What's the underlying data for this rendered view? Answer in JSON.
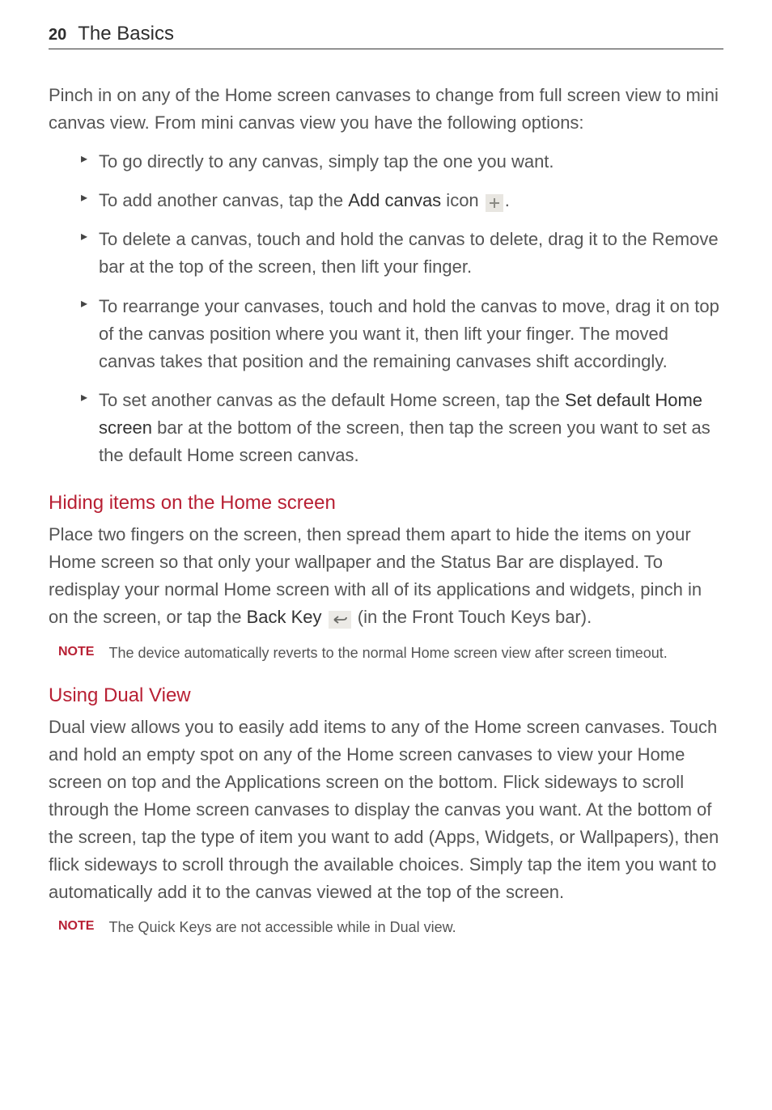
{
  "header": {
    "page_number": "20",
    "section": "The Basics"
  },
  "intro": "Pinch in on any of the Home screen canvases to change from full screen view to mini canvas view. From mini canvas view you have the following options:",
  "bullets": {
    "b1": "To go directly to any canvas, simply tap the one you want.",
    "b2_a": "To add another canvas, tap the ",
    "b2_bold": "Add canvas",
    "b2_b": " icon ",
    "b2_c": ".",
    "b3": "To delete a canvas, touch and hold the canvas to delete, drag it to the Remove bar at the top of the screen, then lift your finger.",
    "b4": "To rearrange your canvases, touch and hold the canvas to move, drag it on top of the canvas position where you want it, then lift your finger. The moved canvas takes that position and the remaining canvases shift accordingly.",
    "b5_a": "To set another canvas as the default Home screen, tap the ",
    "b5_bold": "Set default Home screen",
    "b5_b": " bar at the bottom of the screen, then tap the screen you want to set as the default Home screen canvas."
  },
  "hiding": {
    "heading": "Hiding items on the Home screen",
    "p_a": "Place two fingers on the screen, then spread them apart to hide the items on your Home screen so that only your wallpaper and the Status Bar are displayed. To redisplay your normal Home screen with all of its applications and widgets, pinch in on the screen, or tap the ",
    "p_bold": "Back Key",
    "p_b": " (in the Front Touch Keys bar).",
    "note_label": "NOTE",
    "note_text": "The device automatically reverts to the normal Home screen view after screen timeout."
  },
  "dual": {
    "heading": "Using Dual View",
    "p": "Dual view allows you to easily add items to any of the Home screen canvases. Touch and hold an empty spot on any of the Home screen canvases to view your Home screen on top and the Applications screen on the bottom. Flick sideways to scroll through the Home screen canvases to display the canvas you want. At the bottom of the screen, tap the type of item you want to add (Apps, Widgets, or Wallpapers), then flick sideways to scroll through the available choices. Simply tap the item you want to automatically add it to the canvas viewed at the top of the screen.",
    "note_label": "NOTE",
    "note_text": "The Quick Keys are not accessible while in Dual view."
  }
}
